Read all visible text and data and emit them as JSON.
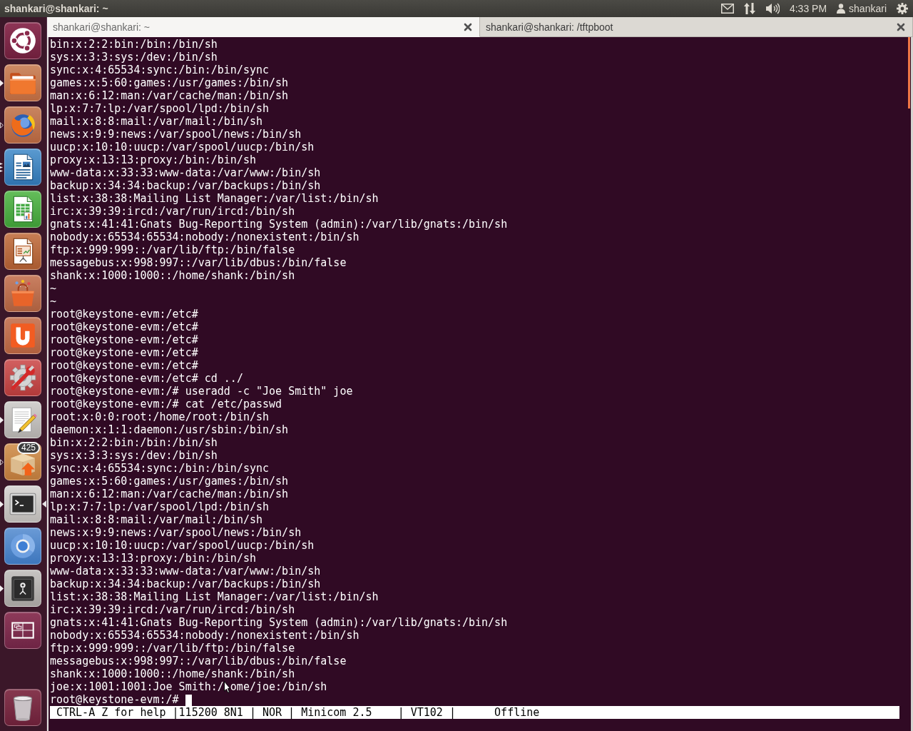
{
  "top_panel": {
    "title": "shankari@shankari: ~",
    "clock": "4:33 PM",
    "user": "shankari"
  },
  "launcher": {
    "items": [
      {
        "kind": "logo",
        "active": false
      },
      {
        "kind": "folder",
        "pips": [
          {
            "outline": false
          }
        ],
        "active": false
      },
      {
        "kind": "browser",
        "pips": [
          {
            "outline": true
          }
        ],
        "active": false
      },
      {
        "kind": "document",
        "pips": [
          {
            "outline": false
          },
          {
            "outline": false
          },
          {
            "outline": false
          }
        ],
        "active": false
      },
      {
        "kind": "spreadsheet",
        "active": false
      },
      {
        "kind": "presentation",
        "active": false
      },
      {
        "kind": "bag",
        "active": false
      },
      {
        "kind": "cup",
        "active": false
      },
      {
        "kind": "settings",
        "active": false
      },
      {
        "kind": "editor",
        "pips": [
          {
            "outline": false
          }
        ],
        "active": false
      },
      {
        "kind": "package",
        "pips": [
          {
            "outline": true
          }
        ],
        "active": false,
        "badge": "425"
      },
      {
        "kind": "terminal",
        "pips": [
          {
            "outline": false
          }
        ],
        "active": true
      },
      {
        "kind": "ring",
        "active": false
      },
      {
        "kind": "safe",
        "pips": [
          {
            "outline": false
          }
        ],
        "active": false
      },
      {
        "kind": "workspaces",
        "active": false
      },
      {
        "kind": "trash",
        "active": false
      }
    ]
  },
  "tabs": [
    {
      "label": "shankari@shankari: ~",
      "selected": true
    },
    {
      "label": "shankari@shankari: /tftpboot",
      "selected": false
    }
  ],
  "terminal": {
    "lines": [
      "bin:x:2:2:bin:/bin:/bin/sh",
      "sys:x:3:3:sys:/dev:/bin/sh",
      "sync:x:4:65534:sync:/bin:/bin/sync",
      "games:x:5:60:games:/usr/games:/bin/sh",
      "man:x:6:12:man:/var/cache/man:/bin/sh",
      "lp:x:7:7:lp:/var/spool/lpd:/bin/sh",
      "mail:x:8:8:mail:/var/mail:/bin/sh",
      "news:x:9:9:news:/var/spool/news:/bin/sh",
      "uucp:x:10:10:uucp:/var/spool/uucp:/bin/sh",
      "proxy:x:13:13:proxy:/bin:/bin/sh",
      "www-data:x:33:33:www-data:/var/www:/bin/sh",
      "backup:x:34:34:backup:/var/backups:/bin/sh",
      "list:x:38:38:Mailing List Manager:/var/list:/bin/sh",
      "irc:x:39:39:ircd:/var/run/ircd:/bin/sh",
      "gnats:x:41:41:Gnats Bug-Reporting System (admin):/var/lib/gnats:/bin/sh",
      "nobody:x:65534:65534:nobody:/nonexistent:/bin/sh",
      "ftp:x:999:999::/var/lib/ftp:/bin/false",
      "messagebus:x:998:997::/var/lib/dbus:/bin/false",
      "shank:x:1000:1000::/home/shank:/bin/sh",
      "~",
      "~",
      "root@keystone-evm:/etc#",
      "root@keystone-evm:/etc#",
      "root@keystone-evm:/etc#",
      "root@keystone-evm:/etc#",
      "root@keystone-evm:/etc#",
      "root@keystone-evm:/etc# cd ../",
      "root@keystone-evm:/# useradd -c \"Joe Smith\" joe",
      "root@keystone-evm:/# cat /etc/passwd",
      "root:x:0:0:root:/home/root:/bin/sh",
      "daemon:x:1:1:daemon:/usr/sbin:/bin/sh",
      "bin:x:2:2:bin:/bin:/bin/sh",
      "sys:x:3:3:sys:/dev:/bin/sh",
      "sync:x:4:65534:sync:/bin:/bin/sync",
      "games:x:5:60:games:/usr/games:/bin/sh",
      "man:x:6:12:man:/var/cache/man:/bin/sh",
      "lp:x:7:7:lp:/var/spool/lpd:/bin/sh",
      "mail:x:8:8:mail:/var/mail:/bin/sh",
      "news:x:9:9:news:/var/spool/news:/bin/sh",
      "uucp:x:10:10:uucp:/var/spool/uucp:/bin/sh",
      "proxy:x:13:13:proxy:/bin:/bin/sh",
      "www-data:x:33:33:www-data:/var/www:/bin/sh",
      "backup:x:34:34:backup:/var/backups:/bin/sh",
      "list:x:38:38:Mailing List Manager:/var/list:/bin/sh",
      "irc:x:39:39:ircd:/var/run/ircd:/bin/sh",
      "gnats:x:41:41:Gnats Bug-Reporting System (admin):/var/lib/gnats:/bin/sh",
      "nobody:x:65534:65534:nobody:/nonexistent:/bin/sh",
      "ftp:x:999:999::/var/lib/ftp:/bin/false",
      "messagebus:x:998:997::/var/lib/dbus:/bin/false",
      "shank:x:1000:1000::/home/shank:/bin/sh",
      [
        "joe:x:1001:1001:Joe Smith:/",
        "ome/joe:/bin/sh"
      ],
      "root@keystone-evm:/#"
    ],
    "cursor": true,
    "status_line": "CTRL-A Z for help |115200 8N1 | NOR | Minicom 2.5    | VT102 |      Offline"
  }
}
